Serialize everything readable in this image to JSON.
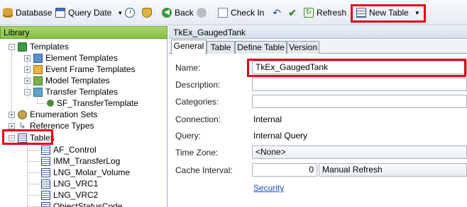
{
  "toolbar": {
    "database_label": "Database",
    "query_date_label": "Query Date",
    "back_label": "Back",
    "check_in_label": "Check In",
    "refresh_label": "Refresh",
    "new_table_label": "New Table"
  },
  "library": {
    "header": "Library",
    "templates": "Templates",
    "element_templates": "Element Templates",
    "event_frame_templates": "Event Frame Templates",
    "model_templates": "Model Templates",
    "transfer_templates": "Transfer Templates",
    "sf_transfer_template": "SF_TransferTemplate",
    "enumeration_sets": "Enumeration Sets",
    "reference_types": "Reference Types",
    "tables": "Tables",
    "table_items": [
      "AF_Control",
      "IMM_TransferLog",
      "LNG_Molar_Volume",
      "LNG_VRC1",
      "LNG_VRC2",
      "ObjectStatusCode"
    ]
  },
  "document": {
    "title": "TkEx_GaugedTank",
    "tabs": [
      "General",
      "Table",
      "Define Table",
      "Version"
    ],
    "labels": {
      "name": "Name:",
      "description": "Description:",
      "categories": "Categories:",
      "connection": "Connection:",
      "query": "Query:",
      "time_zone": "Time Zone:",
      "cache_interval": "Cache Interval:"
    },
    "values": {
      "name": "TkEx_GaugedTank",
      "description": "",
      "categories": "",
      "connection": "Internal",
      "query": "Internal Query",
      "time_zone": "<None>",
      "cache_interval": "0",
      "cache_mode": "Manual Refresh"
    },
    "security_link": "Security"
  }
}
